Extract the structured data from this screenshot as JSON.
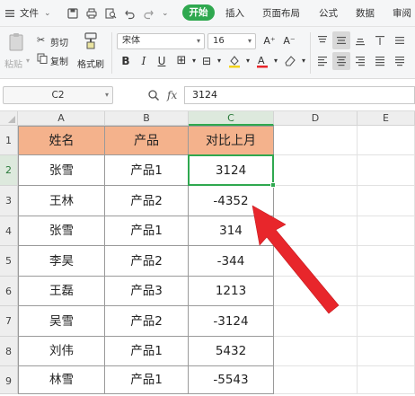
{
  "menubar": {
    "file_label": "文件",
    "home_tab": "开始",
    "insert_tab": "插入",
    "layout_tab": "页面布局",
    "formula_tab": "公式",
    "data_tab": "数据",
    "review_tab": "审阅"
  },
  "ribbon": {
    "paste_label": "粘贴",
    "cut_label": "剪切",
    "copy_label": "复制",
    "format_painter_label": "格式刷",
    "font_name": "宋体",
    "font_size": "16"
  },
  "formula_bar": {
    "name_box": "C2",
    "fx_label": "fx",
    "formula_value": "3124"
  },
  "sheet": {
    "col_headers": [
      "A",
      "B",
      "C",
      "D",
      "E"
    ],
    "row_headers": [
      "1",
      "2",
      "3",
      "4",
      "5",
      "6",
      "7",
      "8",
      "9"
    ],
    "table_header": [
      "姓名",
      "产品",
      "对比上月"
    ],
    "rows": [
      [
        "张雪",
        "产品1",
        "3124"
      ],
      [
        "王林",
        "产品2",
        "-4352"
      ],
      [
        "张雪",
        "产品1",
        "314"
      ],
      [
        "李昊",
        "产品2",
        "-344"
      ],
      [
        "王磊",
        "产品3",
        "1213"
      ],
      [
        "吴雪",
        "产品2",
        "-3124"
      ],
      [
        "刘伟",
        "产品1",
        "5432"
      ],
      [
        "林雪",
        "产品1",
        "-5543"
      ]
    ]
  },
  "colors": {
    "accent_green": "#2fa84f",
    "header_fill": "#f4b28c",
    "arrow_red": "#e8262b"
  }
}
